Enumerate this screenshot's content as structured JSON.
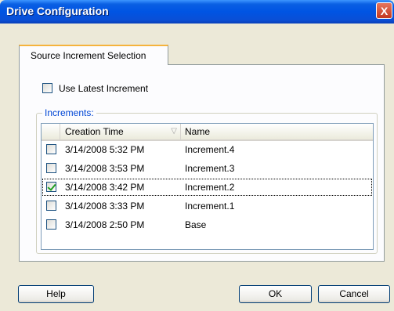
{
  "window": {
    "title": "Drive Configuration",
    "close_glyph": "X"
  },
  "tabs": [
    {
      "label": "Source Increment Selection",
      "active": true
    }
  ],
  "use_latest": {
    "label": "Use Latest Increment",
    "checked": false
  },
  "increments_group": {
    "label": "Increments:"
  },
  "list": {
    "columns": [
      {
        "label": "Creation Time",
        "sort_icon": "sort-descending-icon"
      },
      {
        "label": "Name"
      }
    ],
    "sort_glyph": "▽",
    "rows": [
      {
        "time": "3/14/2008 5:32 PM",
        "name": "Increment.4",
        "checked": false,
        "selected": false
      },
      {
        "time": "3/14/2008 3:53 PM",
        "name": "Increment.3",
        "checked": false,
        "selected": false
      },
      {
        "time": "3/14/2008 3:42 PM",
        "name": "Increment.2",
        "checked": true,
        "selected": true
      },
      {
        "time": "3/14/2008 3:33 PM",
        "name": "Increment.1",
        "checked": false,
        "selected": false
      },
      {
        "time": "3/14/2008 2:50 PM",
        "name": "Base",
        "checked": false,
        "selected": false
      }
    ]
  },
  "buttons": {
    "help": "Help",
    "ok": "OK",
    "cancel": "Cancel"
  },
  "colors": {
    "titlebar": "#0054E3",
    "dialog_bg": "#ECE9D8",
    "group_label": "#0046D5",
    "tab_accent": "#F5B33D",
    "check": "#21A121"
  }
}
